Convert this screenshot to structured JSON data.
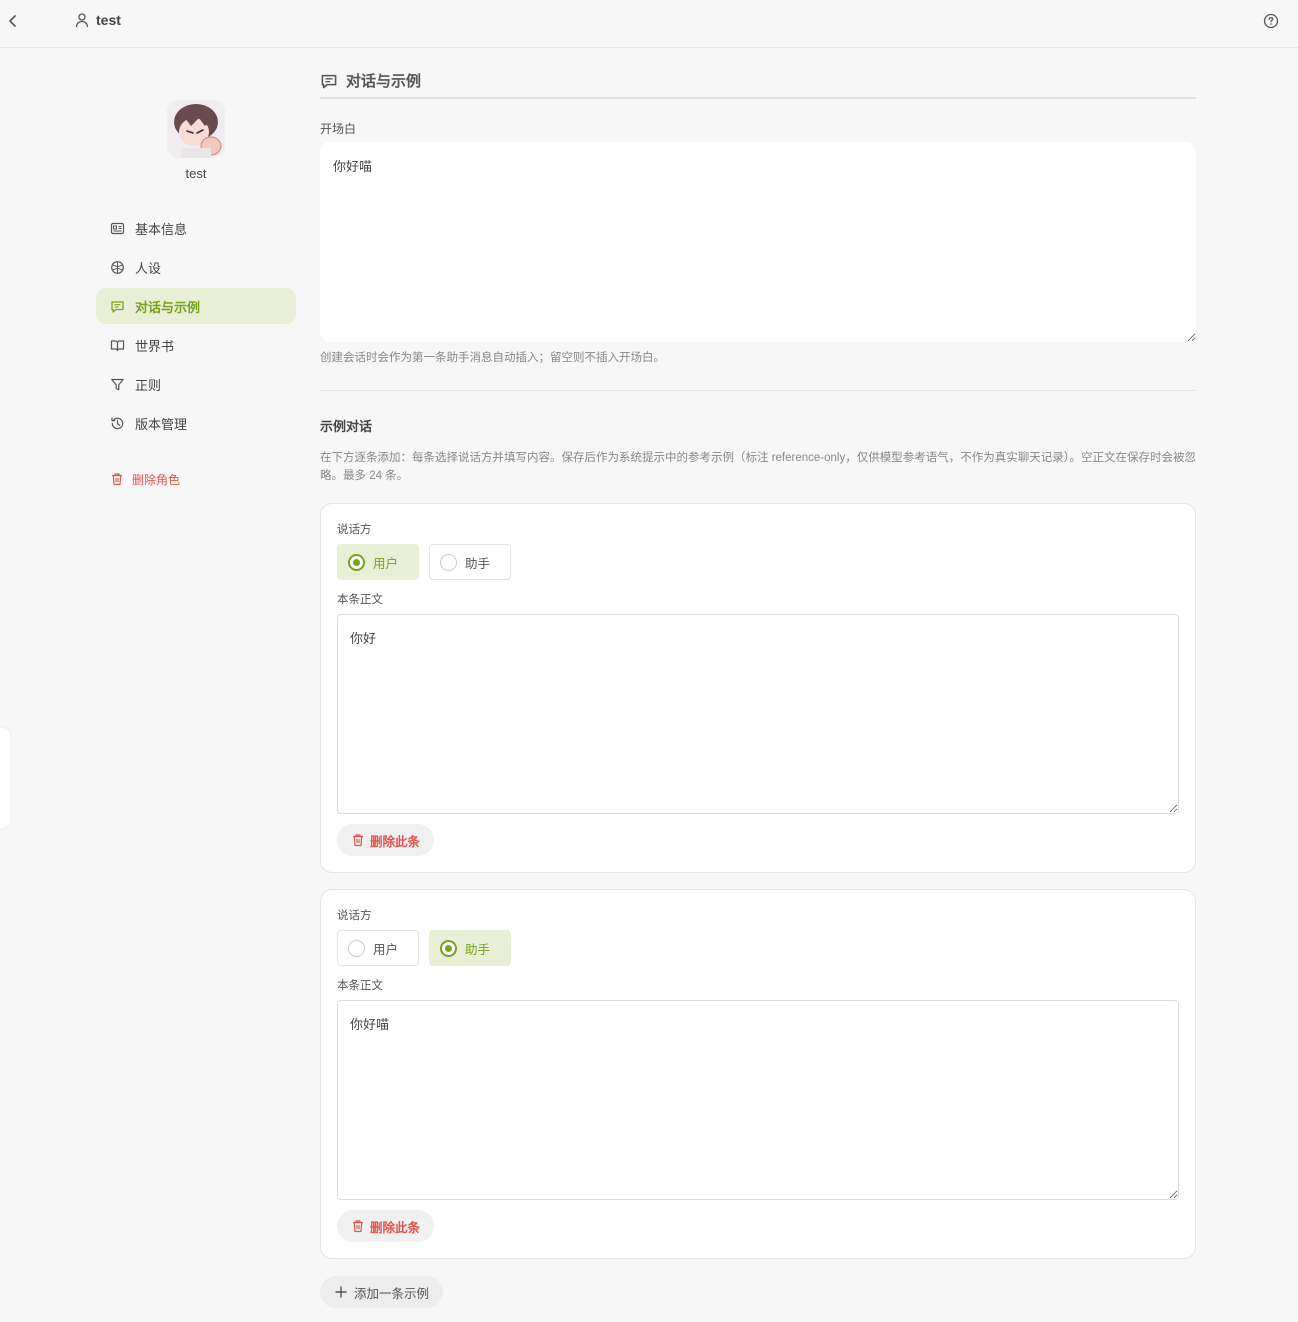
{
  "header": {
    "back_icon": "chevron-left-icon",
    "user_icon": "user-icon",
    "title": "test",
    "help_icon": "help-circle-icon"
  },
  "sidebar": {
    "character_name": "test",
    "items": [
      {
        "label": "基本信息",
        "icon": "id-card-icon",
        "active": false
      },
      {
        "label": "人设",
        "icon": "brain-icon",
        "active": false
      },
      {
        "label": "对话与示例",
        "icon": "message-square-icon",
        "active": true
      },
      {
        "label": "世界书",
        "icon": "book-open-icon",
        "active": false
      },
      {
        "label": "正则",
        "icon": "filter-icon",
        "active": false
      },
      {
        "label": "版本管理",
        "icon": "history-icon",
        "active": false
      }
    ],
    "delete_label": "删除角色"
  },
  "main": {
    "section_title": "对话与示例",
    "greeting": {
      "label": "开场白",
      "value": "你好喵",
      "hint": "创建会话时会作为第一条助手消息自动插入；留空则不插入开场白。"
    },
    "examples": {
      "title": "示例对话",
      "description": "在下方逐条添加：每条选择说话方并填写内容。保存后作为系统提示中的参考示例（标注 reference-only，仅供模型参考语气，不作为真实聊天记录）。空正文在保存时会被忽略。最多 24 条。",
      "speaker_label": "说话方",
      "body_label": "本条正文",
      "option_user": "用户",
      "option_assistant": "助手",
      "delete_label": "删除此条",
      "entries": [
        {
          "speaker": "用户",
          "body": "你好"
        },
        {
          "speaker": "助手",
          "body": "你好喵"
        }
      ],
      "add_label": "添加一条示例"
    }
  },
  "colors": {
    "accent": "#7aa01c",
    "accent_bg": "#e9efd6",
    "danger": "#e0554e"
  }
}
